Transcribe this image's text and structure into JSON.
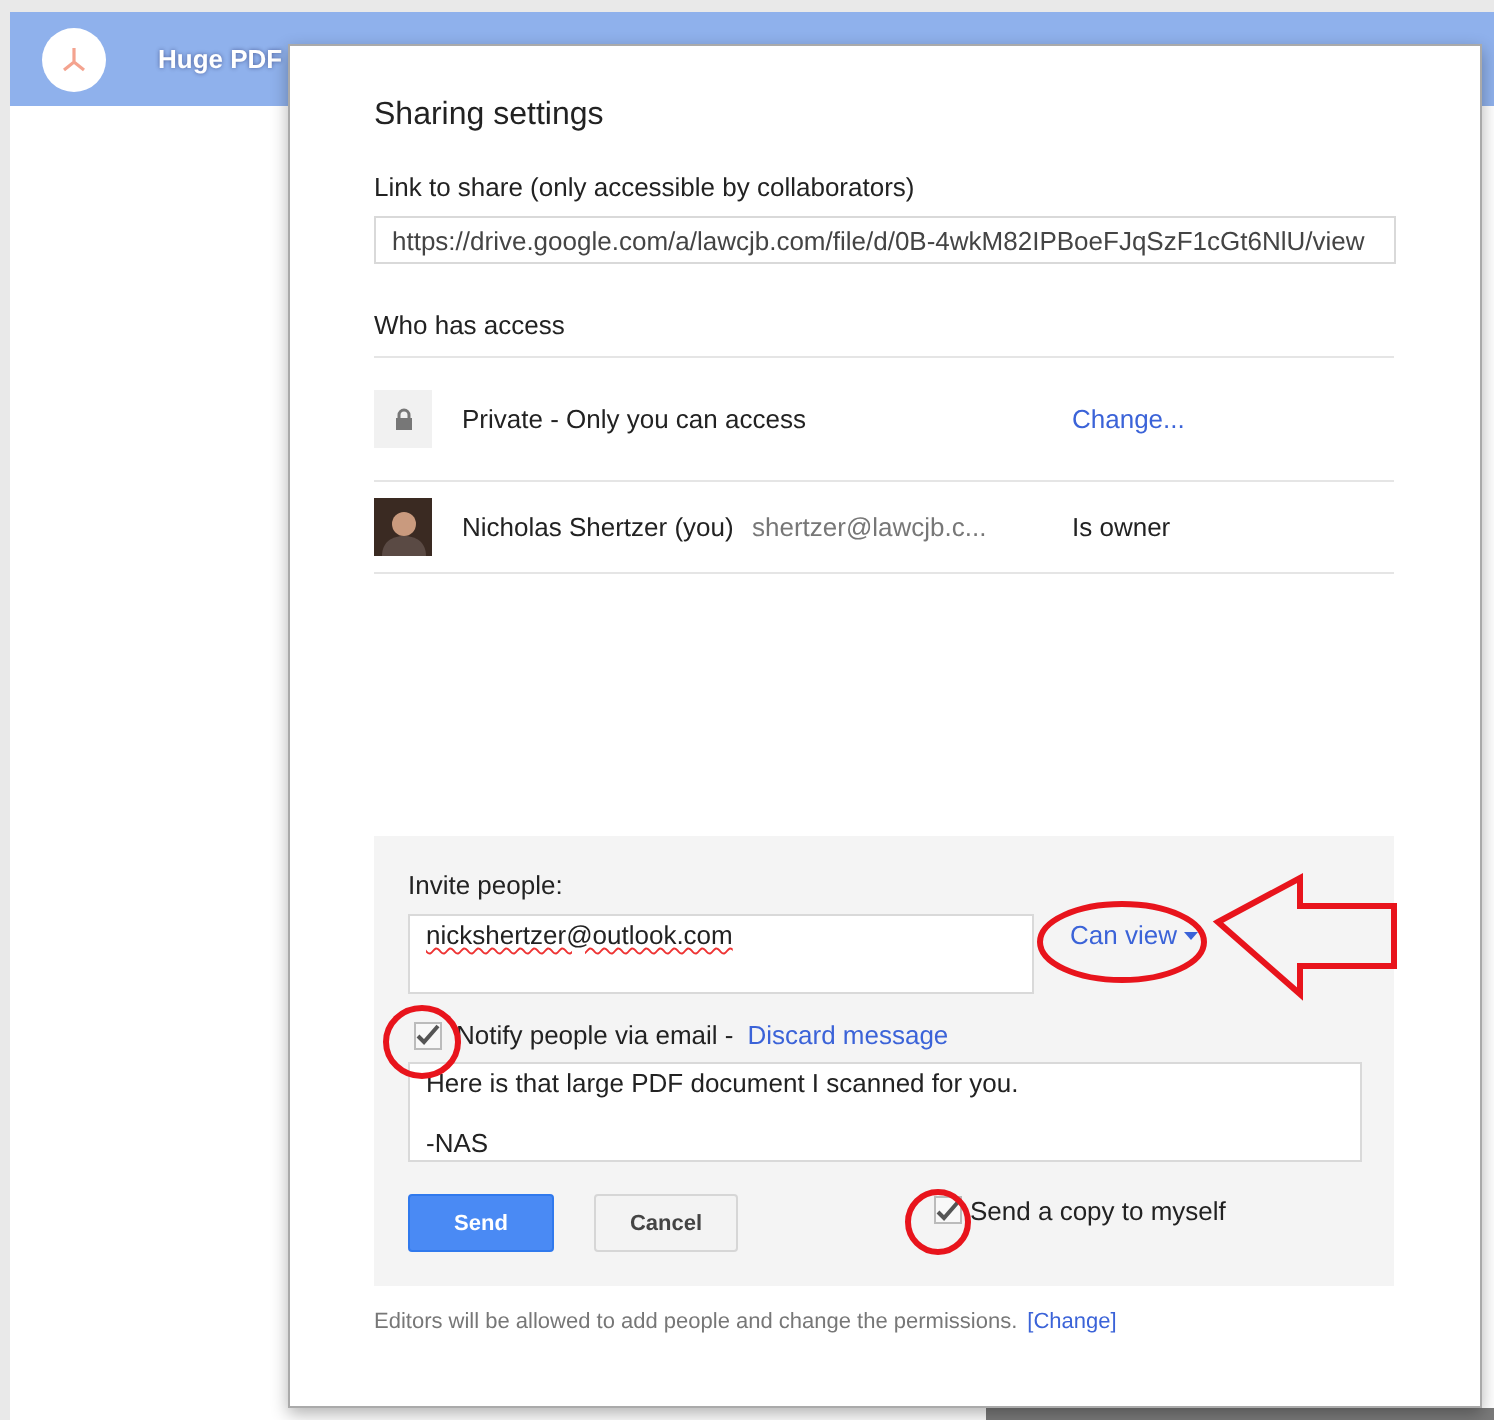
{
  "background": {
    "file_title": "Huge PDF"
  },
  "dialog": {
    "title": "Sharing settings",
    "link_label": "Link to share (only accessible by collaborators)",
    "link_value": "https://drive.google.com/a/lawcjb.com/file/d/0B-4wkM82IPBoeFJqSzF1cGt6NlU/view",
    "access_heading": "Who has access",
    "access_rows": [
      {
        "kind": "visibility",
        "name": "Private - Only you can access",
        "action": "Change..."
      },
      {
        "kind": "person",
        "name": "Nicholas Shertzer (you)",
        "email": "shertzer@lawcjb.c...",
        "role": "Is owner"
      }
    ],
    "invite": {
      "label": "Invite people:",
      "value": "nickshertzer@outlook.com",
      "permission": "Can view",
      "notify_checked": true,
      "notify_label": "Notify people via email - ",
      "discard_link": "Discard message",
      "message_lines": [
        "Here is that large PDF document I scanned for you.",
        "-NAS"
      ],
      "send_button": "Send",
      "cancel_button": "Cancel",
      "copy_checked": true,
      "copy_label": "Send a copy to myself"
    },
    "footer": {
      "text": "Editors will be allowed to add people and change the permissions.",
      "link": "[Change]"
    }
  }
}
